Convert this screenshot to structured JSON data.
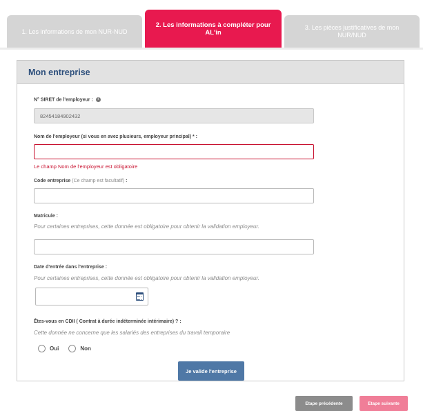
{
  "tabs": [
    {
      "label": "1. Les informations de mon NUR-NUD",
      "active": false
    },
    {
      "label": "2. Les informations à compléter pour AL'in",
      "active": true
    },
    {
      "label": "3. Les pièces justificatives de mon NUR/NUD",
      "active": false
    }
  ],
  "panel": {
    "title": "Mon entreprise"
  },
  "form": {
    "siret_label": "N° SIRET de l'employeur :",
    "siret_info_icon": "i",
    "siret_value": "82454184902432",
    "employer_name_label": "Nom de l'employeur (si vous en avez plusieurs, employeur principal) * :",
    "employer_name_value": "",
    "employer_name_error": "Le champ Nom de l'employeur est obligatoire",
    "company_code_label": "Code entreprise",
    "company_code_optional": "(Ce champ est facultatif)",
    "company_code_colon": " :",
    "company_code_value": "",
    "matricule_label": "Matricule :",
    "matricule_hint": "Pour certaines entreprises, cette donnée est obligatoire pour obtenir la validation employeur.",
    "matricule_value": "",
    "entry_date_label": "Date d'entrée dans l'entreprise :",
    "entry_date_hint": "Pour certaines entreprises, cette donnée est obligatoire pour obtenir la validation employeur.",
    "entry_date_value": "",
    "cdii_label": "Êtes-vous en CDII ( Contrat à durée indéterminée intérimaire) ? :",
    "cdii_hint": "Cette donnée ne concerne que les salariés des entreprises du travail temporaire",
    "cdii_options": [
      "Oui",
      "Non"
    ],
    "submit_label": "Je valide l'entreprise"
  },
  "footer": {
    "prev_label": "Etape précédente",
    "next_label": "Etape suivante"
  },
  "colors": {
    "active_tab": "#e8194f",
    "inactive_tab": "#d5d5d5",
    "title": "#2d4f7c",
    "primary_button": "#4f78a6",
    "error": "#c8102e",
    "prev_button": "#8c8c8c",
    "next_button": "#f07e98"
  }
}
